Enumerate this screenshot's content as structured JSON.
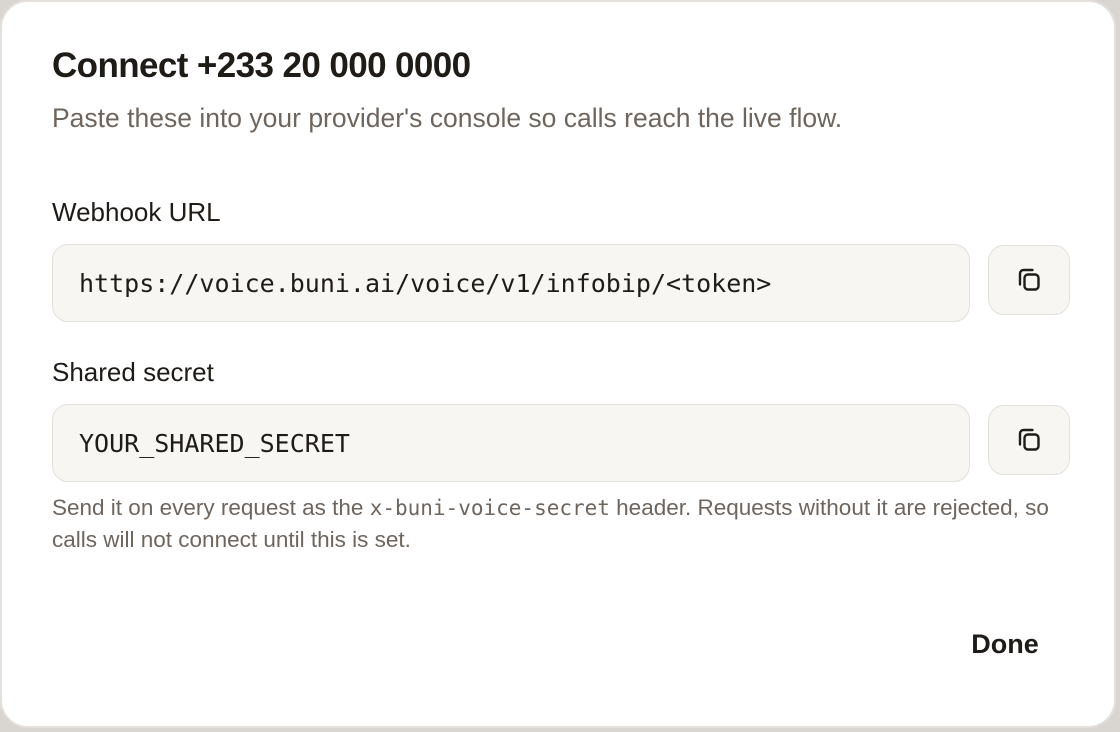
{
  "dialog": {
    "title": "Connect +233 20 000 0000",
    "subtitle": "Paste these into your provider's console so calls reach the live flow."
  },
  "webhook": {
    "label": "Webhook URL",
    "value": "https://voice.buni.ai/voice/v1/infobip/<token>",
    "copy_icon": "copy-icon"
  },
  "secret": {
    "label": "Shared secret",
    "value": "YOUR_SHARED_SECRET",
    "copy_icon": "copy-icon"
  },
  "hint": {
    "before": "Send it on every request as the ",
    "header_name": "x-buni-voice-secret",
    "after": " header. Requests without it are rejected, so calls will not connect until this is set."
  },
  "actions": {
    "done_label": "Done"
  },
  "colors": {
    "text_primary": "#1f1b17",
    "text_secondary": "#6e665e",
    "field_bg": "#f8f6f3",
    "field_border": "#e3dfd9"
  }
}
